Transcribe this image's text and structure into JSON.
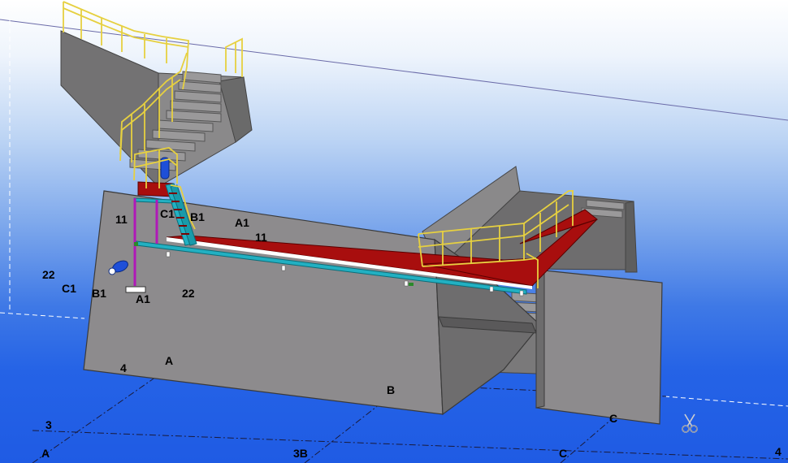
{
  "grid_labels": {
    "left_22": "22",
    "left_c1": "C1",
    "left_b1": "B1",
    "left_a1": "A1",
    "left_22b": "22",
    "left_11": "11",
    "stair_c1": "C1",
    "stair_b1": "B1",
    "deck_a1": "A1",
    "deck_11": "11",
    "axis_4_left": "4",
    "axis_a_top": "A",
    "axis_b": "B",
    "axis_3_left": "3",
    "axis_a_bottom": "A",
    "axis_3b": "3B",
    "axis_c_bottom": "C",
    "axis_c_top": "C",
    "axis_4_right": "4"
  },
  "tool_icon": "scissors-icon",
  "colors": {
    "concrete": "#8c8a8c",
    "handrail": "#e6d040",
    "deck": "#a80e0e",
    "beam": "#1fa7b8",
    "column": "#c020c0",
    "pipe": "#1e4fd8"
  }
}
